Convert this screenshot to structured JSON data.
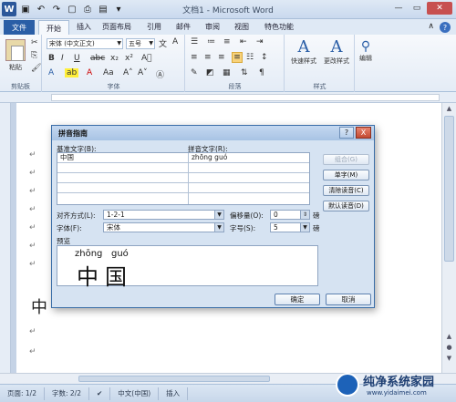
{
  "window": {
    "title": "文档1 - Microsoft Word",
    "logo_letter": "W",
    "qat_icons": [
      "save-icon",
      "undo-icon",
      "redo-icon",
      "new-doc-icon",
      "print-preview-icon",
      "open-icon",
      "customize-icon"
    ]
  },
  "tabs": [
    "文件",
    "开始",
    "插入",
    "页面布局",
    "引用",
    "邮件",
    "审阅",
    "视图",
    "特色功能"
  ],
  "ribbon": {
    "clipboard": {
      "label": "剪贴板",
      "paste": "粘贴"
    },
    "font": {
      "label": "字体",
      "font_name": "宋体 (中文正文)",
      "font_size": "五号"
    },
    "paragraph": {
      "label": "段落"
    },
    "styles": {
      "label": "样式",
      "quick_styles": "快速样式",
      "change_styles": "更改样式"
    },
    "editing": {
      "label": "编辑"
    }
  },
  "dialog": {
    "title": "拼音指南",
    "help_btn": "?",
    "close_btn": "X",
    "base_text_label": "基准文字(B):",
    "ruby_text_label": "拼音文字(R):",
    "base_rows": [
      "中国",
      "",
      "",
      "",
      ""
    ],
    "ruby_rows": [
      "zhōng guó",
      "",
      "",
      "",
      ""
    ],
    "buttons": {
      "combine": "组合(G)",
      "single": "单字(M)",
      "clear": "清除读音(C)",
      "default": "默认读音(D)"
    },
    "alignment_label": "对齐方式(L):",
    "alignment_value": "1-2-1",
    "offset_label": "偏移量(O):",
    "offset_value": "0",
    "offset_unit": "磅",
    "font_label": "字体(F):",
    "font_value": "宋体",
    "size_label": "字号(S):",
    "size_value": "5",
    "size_unit": "磅",
    "preview_label": "预览",
    "preview_pinyin": [
      "zhōng",
      "guó"
    ],
    "preview_chars": [
      "中",
      "国"
    ],
    "ok": "确定",
    "cancel": "取消"
  },
  "document": {
    "visible_char": "中"
  },
  "statusbar": {
    "page": "页面: 1/2",
    "words": "字数: 2/2",
    "language": "中文(中国)",
    "mode": "插入"
  },
  "watermark": {
    "title": "纯净系统家园",
    "url": "www.yidaimei.com"
  }
}
